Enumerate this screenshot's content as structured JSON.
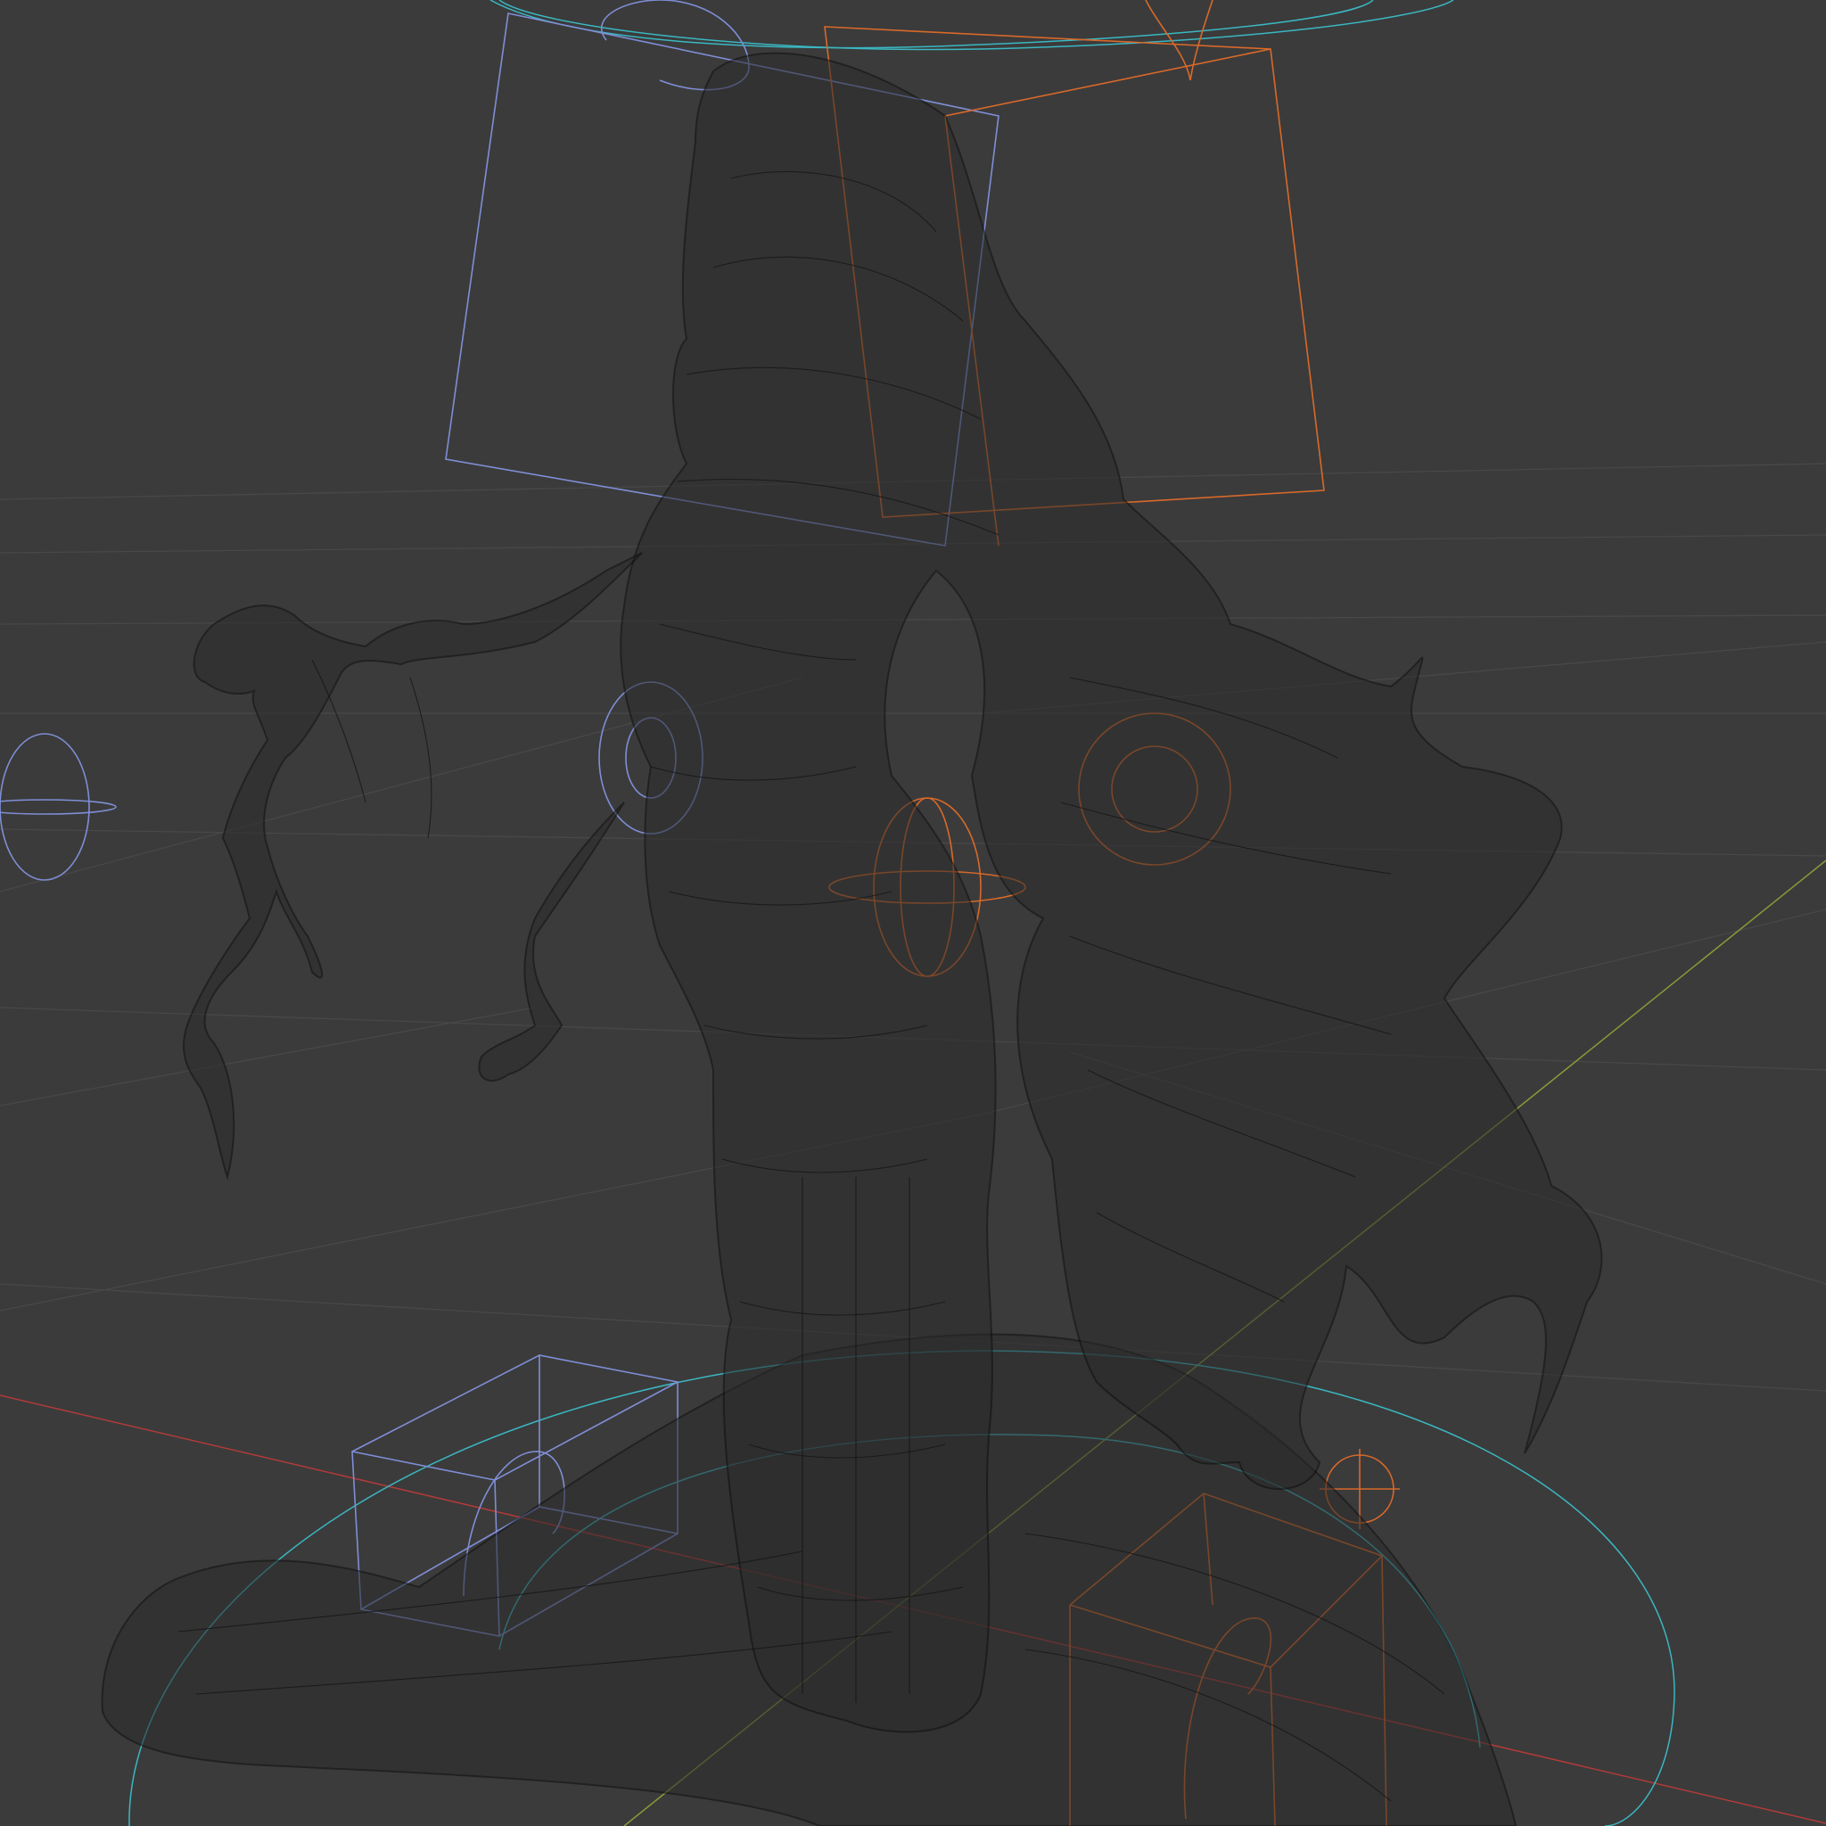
{
  "viewport": {
    "mode": "wireframe",
    "colors": {
      "background": "#3b3b3b",
      "grid": "#4a4a4a",
      "x_axis": "#c03a3a",
      "y_axis": "#8da03a",
      "mesh": "#141414",
      "armature_left": "#7f8ed6",
      "armature_right": "#d8692a",
      "ground_circle": "#3bb7c2"
    }
  }
}
